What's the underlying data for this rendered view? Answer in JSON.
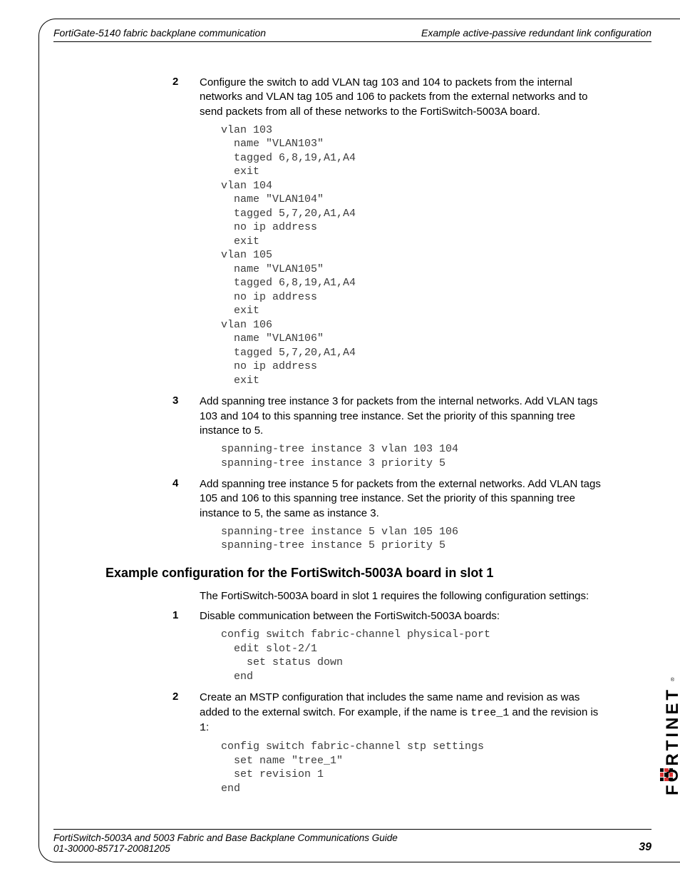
{
  "header": {
    "left": "FortiGate-5140 fabric backplane communication",
    "right": "Example active-passive redundant link configuration"
  },
  "steps_a": [
    {
      "num": "2",
      "text": "Configure the switch to add VLAN tag 103 and 104 to packets from the internal networks and VLAN tag 105 and 106 to packets from the external networks and to send packets from all of these networks to the FortiSwitch-5003A board.",
      "code": "vlan 103\n  name \"VLAN103\"\n  tagged 6,8,19,A1,A4\n  exit\nvlan 104\n  name \"VLAN104\"\n  tagged 5,7,20,A1,A4\n  no ip address\n  exit\nvlan 105\n  name \"VLAN105\"\n  tagged 6,8,19,A1,A4\n  no ip address\n  exit\nvlan 106\n  name \"VLAN106\"\n  tagged 5,7,20,A1,A4\n  no ip address\n  exit"
    },
    {
      "num": "3",
      "text": "Add spanning tree instance 3 for packets from the internal networks. Add VLAN tags 103 and 104 to this spanning tree instance. Set the priority of this spanning tree instance to 5.",
      "code": "spanning-tree instance 3 vlan 103 104\nspanning-tree instance 3 priority 5"
    },
    {
      "num": "4",
      "text": "Add spanning tree instance 5 for packets from the external networks. Add VLAN tags 105 and 106 to this spanning tree instance. Set the priority of this spanning tree instance to 5, the same as instance 3.",
      "code": "spanning-tree instance 5 vlan 105 106\nspanning-tree instance 5 priority 5"
    }
  ],
  "section_heading": "Example configuration for the FortiSwitch-5003A board in slot 1",
  "section_intro": "The FortiSwitch-5003A board in slot 1 requires the following configuration settings:",
  "steps_b": [
    {
      "num": "1",
      "text": "Disable communication between the FortiSwitch-5003A boards:",
      "code": "config switch fabric-channel physical-port\n  edit slot-2/1\n    set status down\n  end"
    },
    {
      "num": "2",
      "text_prefix": "Create an MSTP configuration that includes the same name and revision as was added to the external switch. For example, if the name is ",
      "mono1": "tree_1",
      "text_mid": " and the revision is ",
      "mono2": "1",
      "text_suffix": ":",
      "code": "config switch fabric-channel stp settings\n  set name \"tree_1\"\n  set revision 1\nend"
    }
  ],
  "footer": {
    "line1": "FortiSwitch-5003A and 5003   Fabric and Base Backplane Communications Guide",
    "line2": "01-30000-85717-20081205",
    "page": "39"
  },
  "logo_text": "FORTINET"
}
